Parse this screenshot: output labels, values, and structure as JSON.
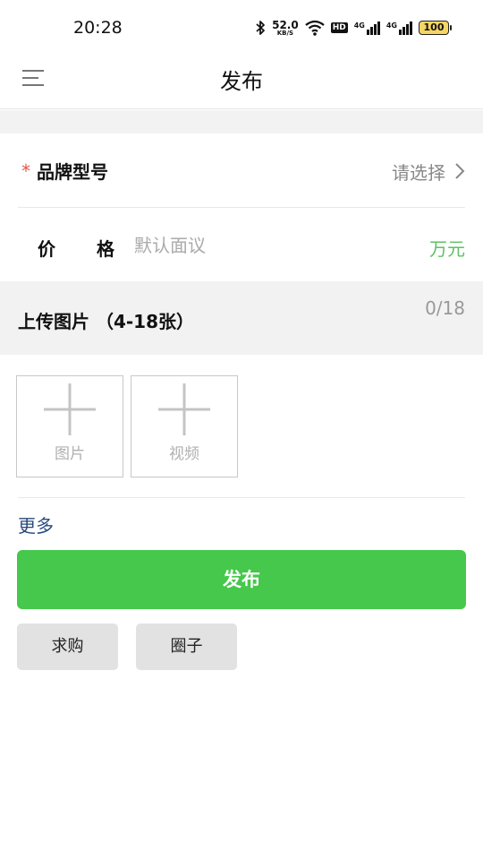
{
  "status_bar": {
    "time": "20:28",
    "network_speed": "52.0",
    "network_speed_unit": "KB/S",
    "hd_label": "HD",
    "signal1_label": "4G",
    "signal2_label": "4G",
    "battery_level": "100",
    "icons": [
      "bluetooth-icon",
      "wifi-icon",
      "signal-icon",
      "battery-icon"
    ]
  },
  "header": {
    "title": "发布",
    "menu_icon": "menu-icon"
  },
  "form": {
    "brand_model": {
      "required_mark": "*",
      "label": "品牌型号",
      "value": "请选择"
    },
    "price": {
      "label": "价格",
      "placeholder": "默认面议",
      "unit": "万元"
    }
  },
  "upload": {
    "title": "上传图片 （4-18张）",
    "count": "0/18",
    "photo_label": "图片",
    "video_label": "视频"
  },
  "more_label": "更多",
  "publish_label": "发布",
  "buttons": {
    "buy_label": "求购",
    "circle_label": "圈子"
  },
  "colors": {
    "accent_green": "#45c84b",
    "unit_green": "#5cc163",
    "required_red": "#e5534b",
    "link_blue": "#2a4a7d"
  }
}
